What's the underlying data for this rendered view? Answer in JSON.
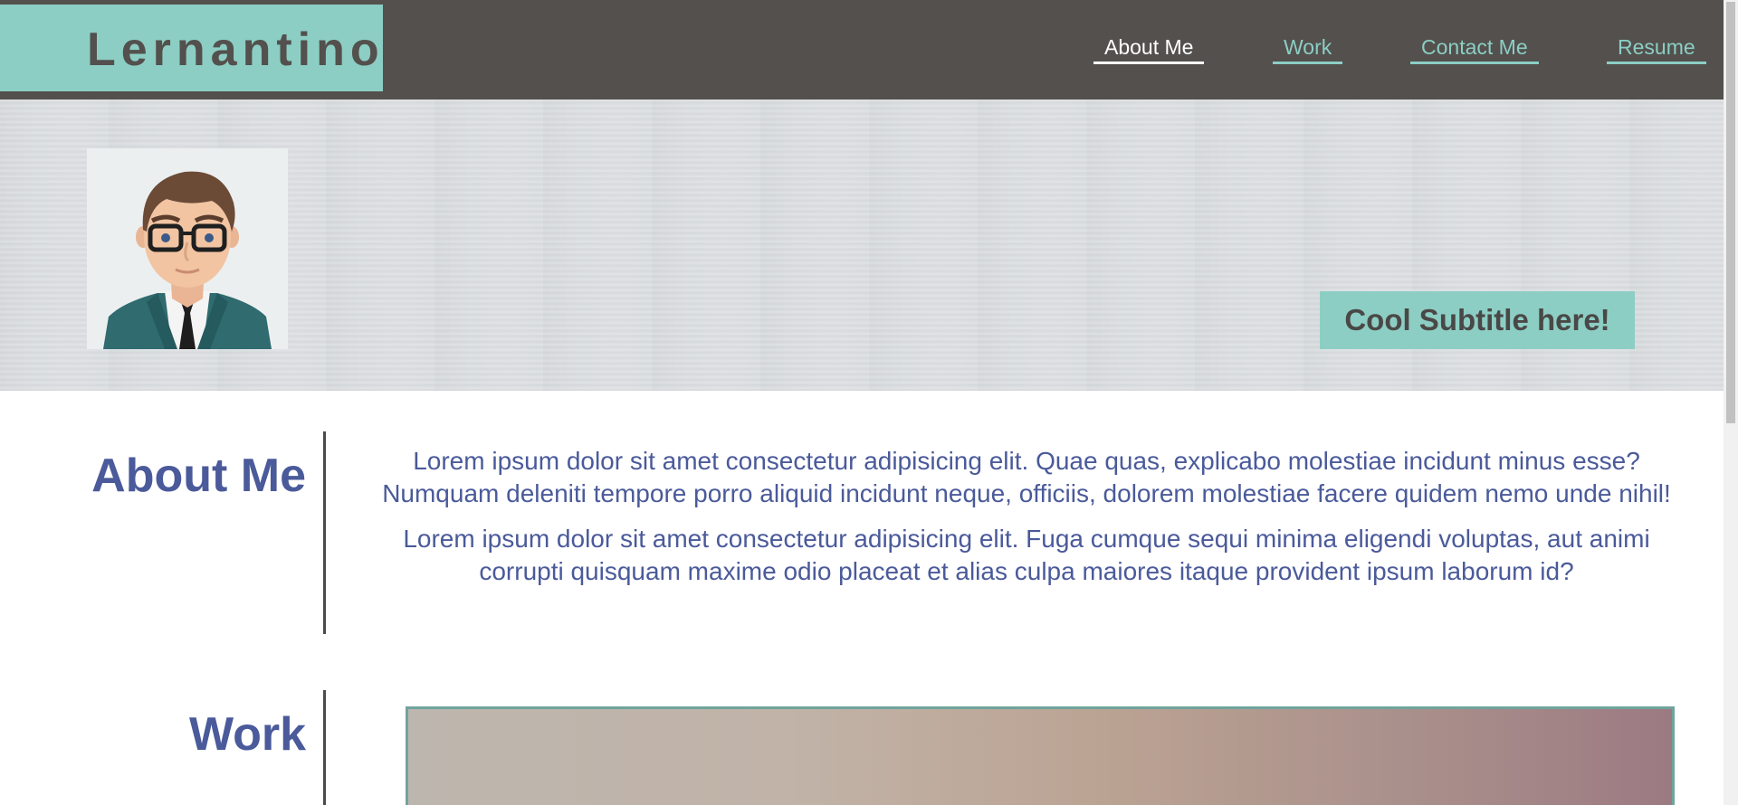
{
  "brand": {
    "name": "Lernantino"
  },
  "nav": {
    "items": [
      {
        "label": "About Me",
        "active": true
      },
      {
        "label": "Work",
        "active": false
      },
      {
        "label": "Contact Me",
        "active": false
      },
      {
        "label": "Resume",
        "active": false
      }
    ]
  },
  "hero": {
    "subtitle": "Cool Subtitle here!",
    "avatar_icon": "avatar-illustration"
  },
  "about": {
    "title": "About Me",
    "paragraphs": [
      "Lorem ipsum dolor sit amet consectetur adipisicing elit. Quae quas, explicabo molestiae incidunt minus esse? Numquam deleniti tempore porro aliquid incidunt neque, officiis, dolorem molestiae facere quidem nemo unde nihil!",
      "Lorem ipsum dolor sit amet consectetur adipisicing elit. Fuga cumque sequi minima eligendi voluptas, aut animi corrupti quisquam maxime odio placeat et alias culpa maiores itaque provident ipsum laborum id?"
    ]
  },
  "work": {
    "title": "Work"
  },
  "colors": {
    "header_bg": "#53504d",
    "accent": "#8ccec4",
    "heading": "#4a5a9a"
  }
}
